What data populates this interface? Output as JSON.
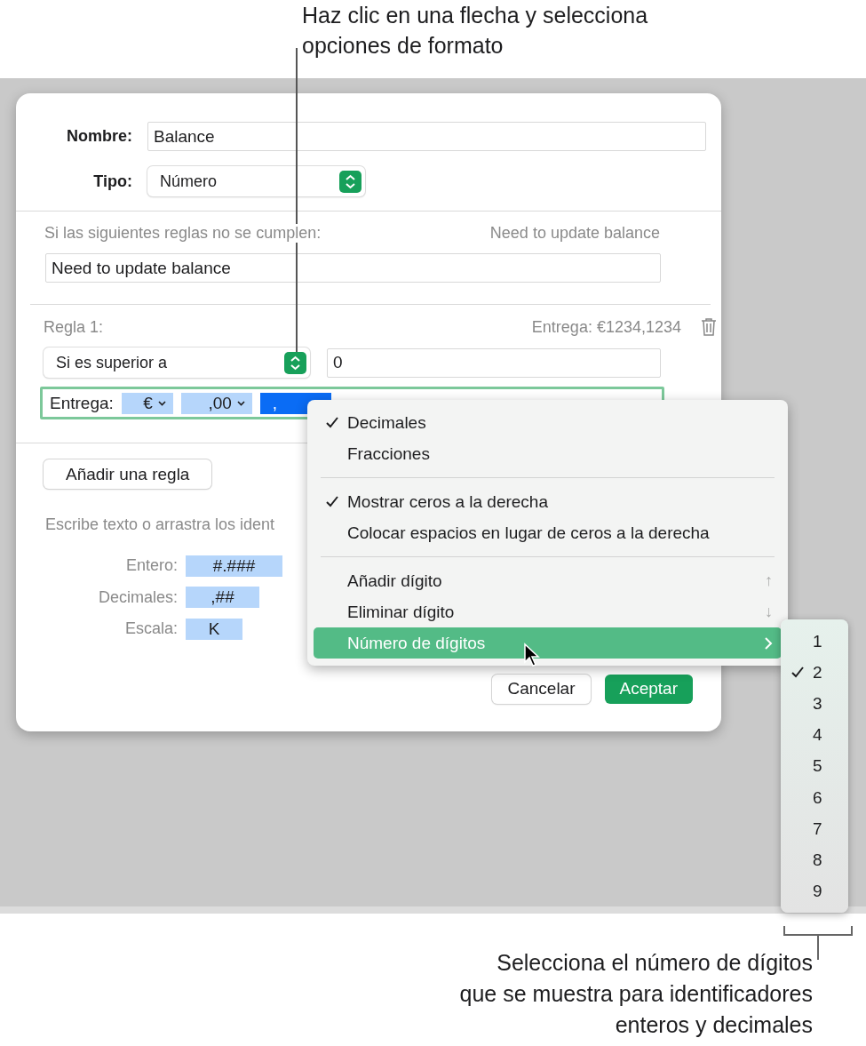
{
  "callout_top": {
    "lines": [
      "Haz clic en una flecha y selecciona",
      "opciones de formato"
    ]
  },
  "dialog": {
    "name_field": {
      "label": "Nombre:",
      "value": "Balance"
    },
    "type_field": {
      "label": "Tipo:",
      "value": "Número"
    },
    "unmet": {
      "label": "Si las siguientes reglas no se cumplen:",
      "preview": "Need to update balance",
      "value": "Need to update balance"
    },
    "rule": {
      "title": "Regla 1:",
      "preview": "Entrega: €1234,1234",
      "condition": "Si es superior a",
      "value": "0",
      "format_label": "Entrega:",
      "tokens": [
        {
          "text": "€",
          "dropdown": true,
          "selected": false
        },
        {
          "text": ",00",
          "dropdown": true,
          "selected": false
        },
        {
          "text": ",",
          "dropdown": false,
          "selected": true
        }
      ]
    },
    "add_rule": "Añadir una regla",
    "hint": "Escribe texto o arrastra los ident",
    "identifiers": [
      {
        "label": "Entero:",
        "token": "#.###"
      },
      {
        "label": "Decimales:",
        "token": ",##"
      },
      {
        "label": "Escala:",
        "token": "K"
      }
    ],
    "buttons": [
      {
        "label": "Cancelar",
        "kind": "secondary"
      },
      {
        "label": "Aceptar",
        "kind": "primary"
      }
    ]
  },
  "menu": {
    "sections": [
      [
        {
          "label": "Decimales",
          "checked": true,
          "selected": false
        },
        {
          "label": "Fracciones",
          "checked": false,
          "selected": false
        }
      ],
      [
        {
          "label": "Mostrar ceros a la derecha",
          "checked": true,
          "selected": false
        },
        {
          "label": "Colocar espacios en lugar de ceros a la derecha",
          "checked": false,
          "selected": false
        }
      ],
      [
        {
          "label": "Añadir dígito",
          "checked": false,
          "selected": false,
          "shortcut": "↑"
        },
        {
          "label": "Eliminar dígito",
          "checked": false,
          "selected": false,
          "shortcut": "↓"
        },
        {
          "label": "Número de dígitos",
          "checked": false,
          "selected": true,
          "submenu": true
        }
      ]
    ]
  },
  "submenu": {
    "items": [
      {
        "label": "1",
        "checked": false
      },
      {
        "label": "2",
        "checked": true
      },
      {
        "label": "3",
        "checked": false
      },
      {
        "label": "4",
        "checked": false
      },
      {
        "label": "5",
        "checked": false
      },
      {
        "label": "6",
        "checked": false
      },
      {
        "label": "7",
        "checked": false
      },
      {
        "label": "8",
        "checked": false
      },
      {
        "label": "9",
        "checked": false
      }
    ]
  },
  "callout_bottom": {
    "lines": [
      "Selecciona el número de dígitos",
      "que se muestra para identificadores",
      "enteros y decimales"
    ]
  }
}
